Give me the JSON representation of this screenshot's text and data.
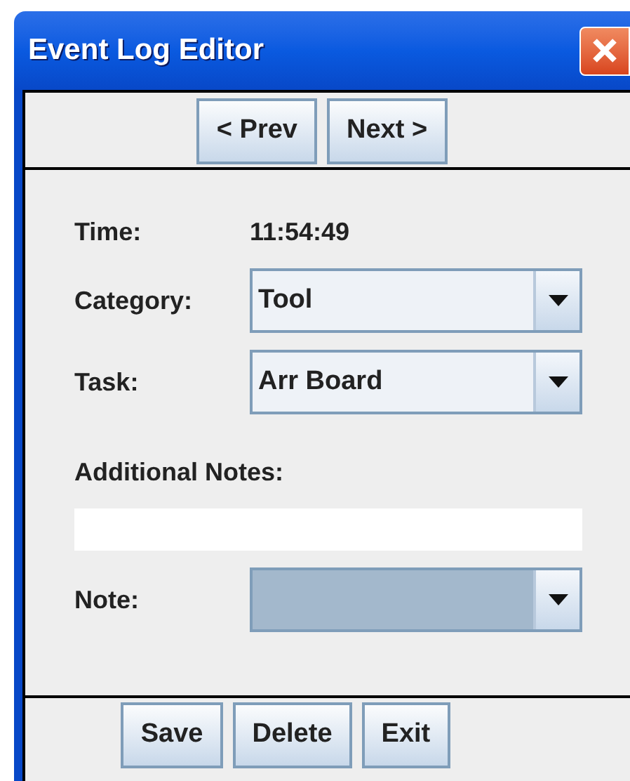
{
  "window": {
    "title": "Event Log Editor"
  },
  "nav_buttons": [
    "< Prev",
    "Next >"
  ],
  "form": [
    {
      "kind": "text",
      "label": "Time:",
      "value": "11:54:49"
    },
    {
      "kind": "combo",
      "label": "Category:",
      "value": "Tool",
      "focused": false
    },
    {
      "kind": "combo",
      "label": "Task:",
      "value": "Arr Board",
      "focused": false
    },
    {
      "kind": "heading",
      "label": "Additional Notes:"
    },
    {
      "kind": "input"
    },
    {
      "kind": "combo",
      "label": "Note:",
      "focused": true
    }
  ],
  "buttons": [
    "Save",
    "Delete",
    "Exit"
  ]
}
